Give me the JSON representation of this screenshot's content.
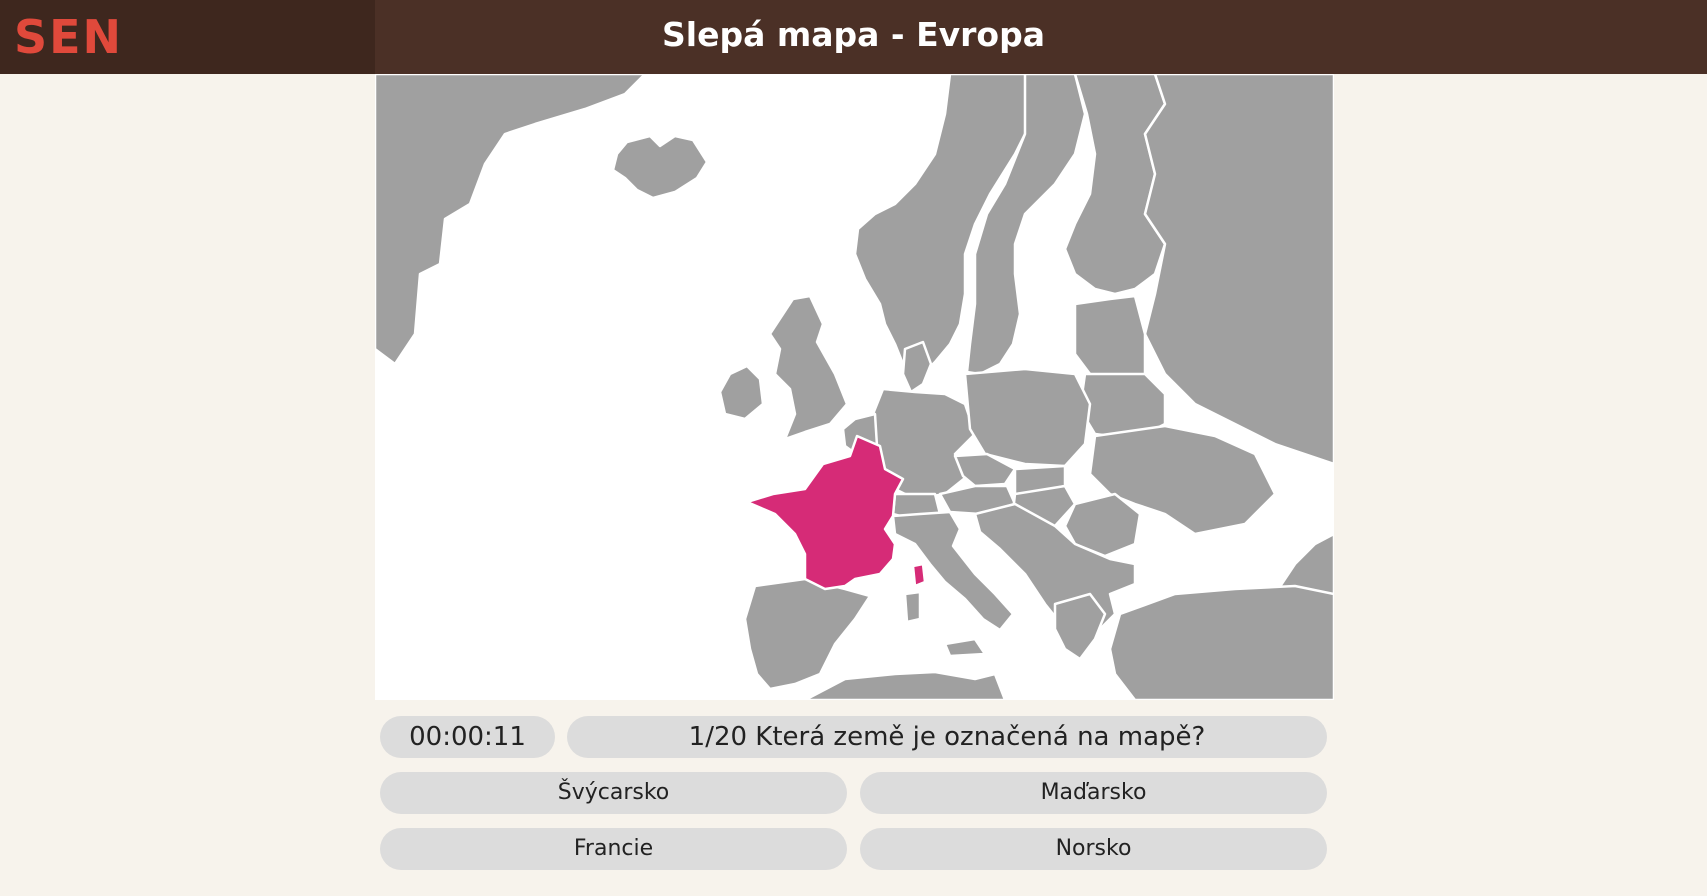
{
  "header": {
    "logo_text": "SEN",
    "title": "Slepá mapa - Evropa"
  },
  "quiz": {
    "timer": "00:00:11",
    "question": "1/20 Která země je označená na mapě?",
    "answers": [
      "Švýcarsko",
      "Maďarsko",
      "Francie",
      "Norsko"
    ],
    "highlighted_country": "Francie"
  },
  "colors": {
    "header_bg": "#4b3026",
    "logo": "#e0493b",
    "land": "#a0a0a0",
    "highlight": "#d62b77",
    "sea": "#ffffff",
    "page_bg": "#f7f3ec",
    "pill_bg": "#dcdcdc"
  }
}
